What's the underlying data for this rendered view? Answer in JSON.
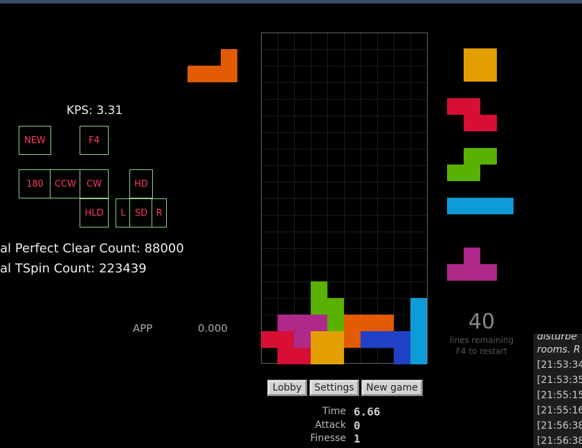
{
  "kps": "KPS: 3.31",
  "keys": {
    "new": "NEW",
    "f4": "F4",
    "r180": "180",
    "ccw": "CCW",
    "cw": "CW",
    "hd": "HD",
    "hld": "HLD",
    "left": "L",
    "sd": "SD",
    "right": "R"
  },
  "stats": {
    "perfect_clear": "al Perfect Clear Count: 88000",
    "tspin": "al TSpin Count: 223439"
  },
  "app": {
    "label": "APP",
    "value": "0.000"
  },
  "lines": {
    "count": "40",
    "remaining_label": "lines remaining",
    "restart_label": "F4 to restart"
  },
  "buttons": {
    "lobby": "Lobby",
    "settings": "Settings",
    "new_game": "New game"
  },
  "metrics": {
    "time_label": "Time",
    "time_value": "6.66",
    "attack_label": "Attack",
    "attack_value": "0",
    "finesse_label": "Finesse",
    "finesse_value": "1"
  },
  "chat": {
    "lines": [
      "disturbe",
      "rooms. R",
      "[21:53:34",
      "[21:53:35",
      "[21:55:15",
      "[21:55:16",
      "[21:56:38",
      "[21:56:38"
    ]
  },
  "colors": {
    "I": "#0f9bd7",
    "O": "#e39f02",
    "T": "#af298a",
    "S": "#59b101",
    "Z": "#d70f37",
    "L": "#e35b02",
    "J": "#2141c6",
    "key_border": "#8fd48a",
    "key_text": "#ff3a5c"
  },
  "hold_piece": "L",
  "next_queue": [
    "O",
    "Z",
    "S",
    "I",
    "T"
  ],
  "board": {
    "rows": 20,
    "cols": 10,
    "stack": [
      "..........",
      "..........",
      "..........",
      "..........",
      "..........",
      "..........",
      "..........",
      "..........",
      "..........",
      "..........",
      "..........",
      "..........",
      "..........",
      "..........",
      "..........",
      "...S......",
      "...SS....I",
      ".TTTSLLL.I",
      "ZZTOOLJJJI",
      ".ZZOO...JI"
    ]
  }
}
